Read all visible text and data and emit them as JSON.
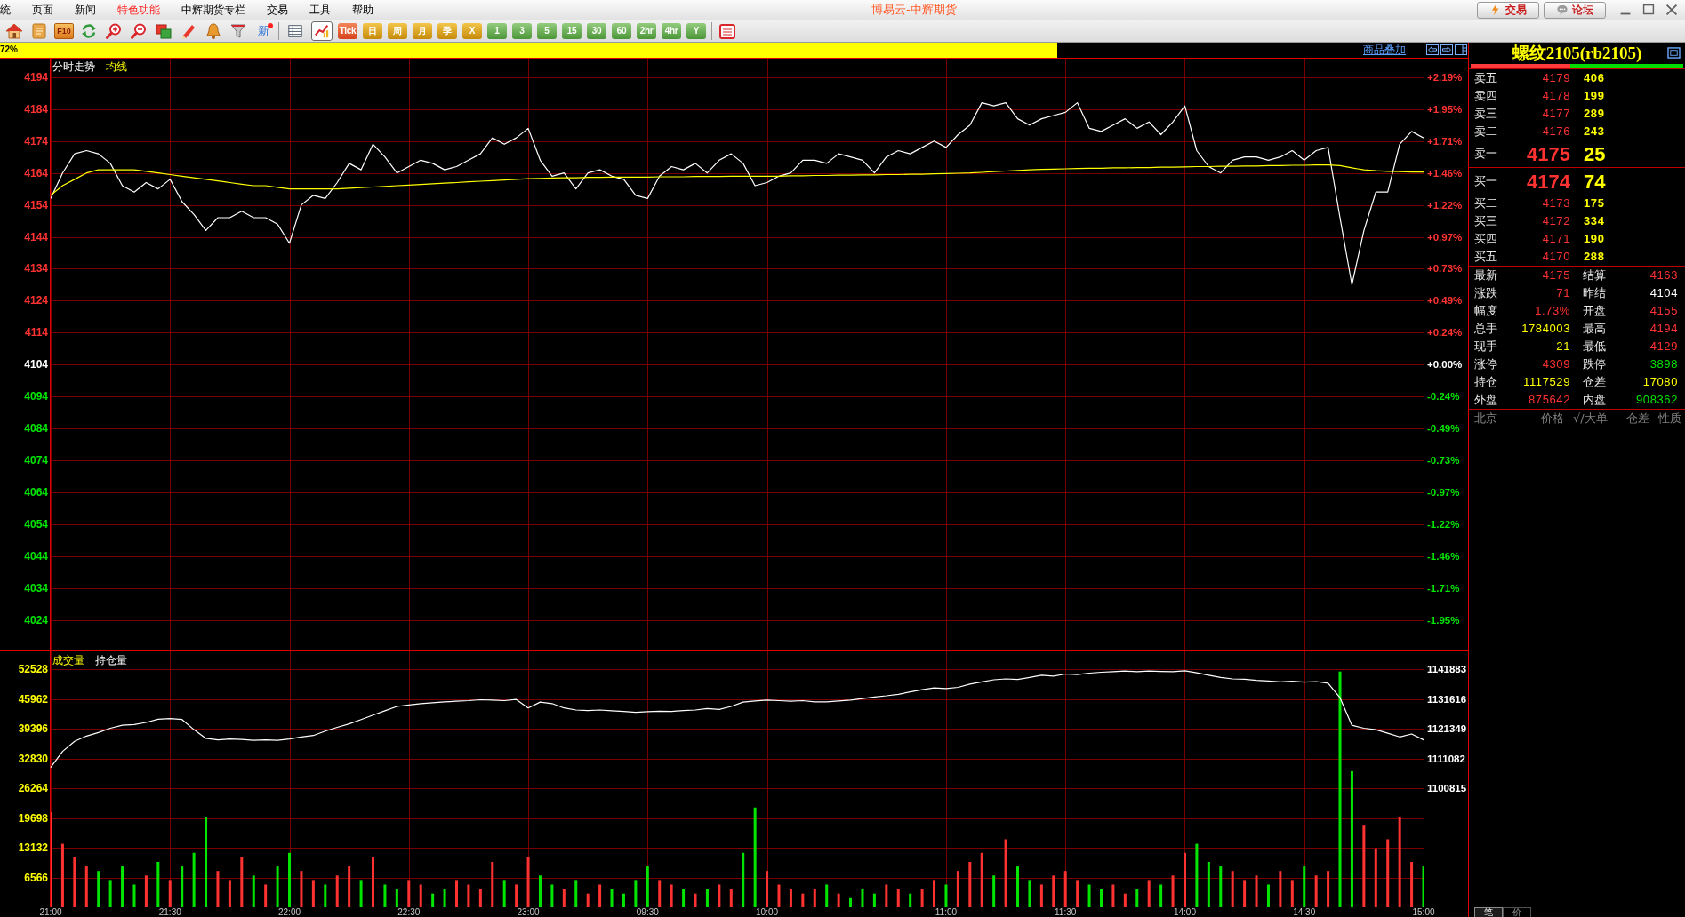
{
  "window": {
    "title": "博易云-中辉期货",
    "buttons": [
      {
        "label": "交易"
      },
      {
        "label": "论坛"
      }
    ]
  },
  "menu": [
    {
      "label": "统",
      "highlighted": false
    },
    {
      "label": "页面",
      "highlighted": false
    },
    {
      "label": "新闻",
      "highlighted": false
    },
    {
      "label": "特色功能",
      "highlighted": true
    },
    {
      "label": "中辉期货专栏",
      "highlighted": false
    },
    {
      "label": "交易",
      "highlighted": false
    },
    {
      "label": "工具",
      "highlighted": false
    },
    {
      "label": "帮助",
      "highlighted": false
    }
  ],
  "toolbar": {
    "doc_label": "F10",
    "news_label": "新",
    "views": [
      {
        "selected": false
      },
      {
        "selected": true
      }
    ],
    "periods": [
      {
        "label": "Tick",
        "kind": "tick"
      },
      {
        "label": "日",
        "kind": "day"
      },
      {
        "label": "周",
        "kind": "day"
      },
      {
        "label": "月",
        "kind": "day"
      },
      {
        "label": "季",
        "kind": "day"
      },
      {
        "label": "X",
        "kind": "day"
      },
      {
        "label": "1",
        "kind": "minute"
      },
      {
        "label": "3",
        "kind": "minute"
      },
      {
        "label": "5",
        "kind": "minute"
      },
      {
        "label": "15",
        "kind": "minute"
      },
      {
        "label": "30",
        "kind": "minute"
      },
      {
        "label": "60",
        "kind": "minute"
      },
      {
        "label": "2hr",
        "kind": "minute"
      },
      {
        "label": "4hr",
        "kind": "minute"
      },
      {
        "label": "Y",
        "kind": "minute"
      }
    ]
  },
  "status_bar": {
    "progress": {
      "level": 0.72,
      "label": "72%"
    },
    "link": "商品叠加"
  },
  "price_panel": {
    "chart_data": {
      "type": "line",
      "grid": true,
      "ylim": [
        4014.5,
        4199.8
      ],
      "yticks": [
        4194,
        4184,
        4174,
        4164,
        4154,
        4144,
        4134,
        4124,
        4114,
        4104,
        4094,
        4084,
        4074,
        4064,
        4054,
        4044,
        4034,
        4024
      ],
      "series": [
        {
          "name": "分时走势",
          "color": "#ffffff",
          "values": [
            4156,
            4164,
            4170,
            4171,
            4170,
            4167,
            4160,
            4158,
            4161,
            4159,
            4162,
            4155,
            4151,
            4146,
            4150,
            4150,
            4152,
            4150,
            4150,
            4148,
            4142,
            4154,
            4157,
            4156,
            4161,
            4167,
            4165,
            4173,
            4169,
            4164,
            4166,
            4168,
            4167,
            4165,
            4166,
            4168,
            4170,
            4175,
            4173,
            4175,
            4178,
            4168,
            4163,
            4164,
            4159,
            4164,
            4165,
            4163,
            4162,
            4157,
            4156,
            4163,
            4166,
            4165,
            4167,
            4164,
            4168,
            4170,
            4167,
            4160,
            4161,
            4163,
            4164,
            4168,
            4168,
            4167,
            4170,
            4169,
            4168,
            4164,
            4169,
            4171,
            4170,
            4172,
            4174,
            4172,
            4176,
            4179,
            4186,
            4185,
            4186,
            4181,
            4179,
            4181,
            4182,
            4183,
            4186,
            4178,
            4177,
            4179,
            4181,
            4178,
            4180,
            4176,
            4180,
            4185,
            4171,
            4166,
            4164,
            4168,
            4169,
            4169,
            4168,
            4169,
            4171,
            4168,
            4171,
            4172,
            4150,
            4129,
            4146,
            4158,
            4158,
            4173,
            4177,
            4175
          ]
        },
        {
          "name": "均线",
          "color": "#ffff00",
          "values": [
            4157,
            4160,
            4162,
            4164,
            4165,
            4165,
            4165,
            4165,
            4164.5,
            4164,
            4163.5,
            4163,
            4162.5,
            4162,
            4161.5,
            4161,
            4160.5,
            4160,
            4160,
            4159.5,
            4159,
            4159,
            4159,
            4159,
            4159,
            4159.2,
            4159.4,
            4159.6,
            4159.8,
            4160,
            4160.2,
            4160.4,
            4160.6,
            4160.8,
            4161,
            4161.2,
            4161.4,
            4161.6,
            4161.8,
            4162,
            4162.2,
            4162.3,
            4162.4,
            4162.5,
            4162.5,
            4162.6,
            4162.6,
            4162.7,
            4162.7,
            4162.7,
            4162.7,
            4162.8,
            4162.8,
            4162.8,
            4162.9,
            4162.9,
            4162.9,
            4163,
            4163,
            4163,
            4163,
            4163,
            4163.1,
            4163.1,
            4163.2,
            4163.2,
            4163.3,
            4163.3,
            4163.4,
            4163.4,
            4163.5,
            4163.5,
            4163.6,
            4163.6,
            4163.7,
            4163.8,
            4163.9,
            4164,
            4164.2,
            4164.4,
            4164.6,
            4164.8,
            4165,
            4165.1,
            4165.2,
            4165.3,
            4165.4,
            4165.5,
            4165.5,
            4165.6,
            4165.6,
            4165.7,
            4165.7,
            4165.8,
            4165.8,
            4165.9,
            4166,
            4166,
            4166.1,
            4166.1,
            4166.2,
            4166.2,
            4166.3,
            4166.3,
            4166.4,
            4166.4,
            4166.5,
            4166.5,
            4166.3,
            4165.6,
            4165,
            4164.7,
            4164.5,
            4164.4,
            4164.3,
            4164.3
          ]
        }
      ]
    },
    "right_axis_labels": [
      "+2.19%",
      "+1.95%",
      "+1.71%",
      "+1.46%",
      "+1.22%",
      "+0.97%",
      "+0.73%",
      "+0.49%",
      "+0.24%",
      "+0.00%",
      "-0.24%",
      "-0.49%",
      "-0.73%",
      "-0.97%",
      "-1.22%",
      "-1.46%",
      "-1.71%",
      "-1.95%"
    ]
  },
  "volume_panel": {
    "volume": {
      "chart_data": {
        "type": "bar",
        "grid": true,
        "categories": [
          "21:00",
          null,
          null,
          null,
          null,
          null,
          null,
          null,
          null,
          null,
          "21:30",
          null,
          null,
          null,
          null,
          null,
          null,
          null,
          null,
          null,
          "22:00",
          null,
          null,
          null,
          null,
          null,
          null,
          null,
          null,
          null,
          "22:30",
          null,
          null,
          null,
          null,
          null,
          null,
          null,
          null,
          null,
          "23:00",
          null,
          null,
          null,
          null,
          null,
          null,
          null,
          null,
          null,
          "09:30",
          null,
          null,
          null,
          null,
          null,
          null,
          null,
          null,
          null,
          "10:00",
          null,
          null,
          null,
          null,
          null,
          null,
          null,
          null,
          null,
          null,
          null,
          null,
          null,
          null,
          "11:00",
          null,
          null,
          null,
          null,
          null,
          null,
          null,
          null,
          null,
          "11:30",
          null,
          null,
          null,
          null,
          null,
          null,
          null,
          null,
          null,
          "14:00",
          null,
          null,
          null,
          null,
          null,
          null,
          null,
          null,
          null,
          "14:30",
          null,
          null,
          null,
          null,
          null,
          null,
          null,
          null,
          null,
          "15:00"
        ],
        "ylim": [
          0,
          56448
        ],
        "yticks": [
          52528,
          45962,
          39396,
          32830,
          26264,
          19698,
          13132,
          6566
        ],
        "series": [
          {
            "name": "成交量",
            "values": [
              21000,
              14000,
              11000,
              9000,
              8000,
              6000,
              9000,
              5000,
              7000,
              10000,
              6000,
              9000,
              12000,
              20000,
              8000,
              6000,
              11000,
              7000,
              5000,
              9000,
              12000,
              8000,
              6000,
              5000,
              7000,
              9000,
              6000,
              11000,
              5000,
              4000,
              6000,
              5000,
              3000,
              4000,
              6000,
              5000,
              4000,
              10000,
              6000,
              5000,
              11000,
              7000,
              5000,
              4000,
              6000,
              3000,
              5000,
              4000,
              3000,
              6000,
              9000,
              6000,
              5000,
              4000,
              3000,
              4000,
              5000,
              4000,
              12000,
              22000,
              8000,
              5000,
              4000,
              3000,
              4000,
              5000,
              3000,
              2000,
              4000,
              3000,
              5000,
              4000,
              3000,
              4000,
              6000,
              5000,
              8000,
              10000,
              12000,
              7000,
              15000,
              9000,
              6000,
              5000,
              7000,
              8000,
              6000,
              5000,
              4000,
              5000,
              3000,
              4000,
              6000,
              5000,
              7000,
              12000,
              14000,
              10000,
              9000,
              8000,
              6000,
              7000,
              5000,
              8000,
              6000,
              9000,
              7000,
              8000,
              52000,
              30000,
              18000,
              13000,
              15000,
              20000,
              10000,
              9000
            ]
          }
        ]
      }
    },
    "open_interest": {
      "chart_data": {
        "type": "line",
        "ylim": [
          1100815,
          1141883
        ],
        "yticks": [
          1141883,
          1131616,
          1121349,
          1111082,
          1100815
        ],
        "series": [
          {
            "name": "持仓量",
            "color": "#ffffff",
            "values": [
              1108000,
              1113500,
              1117000,
              1118800,
              1120000,
              1121500,
              1122500,
              1122800,
              1123500,
              1124600,
              1124800,
              1124500,
              1121000,
              1118000,
              1117500,
              1117800,
              1117600,
              1117300,
              1117500,
              1117300,
              1117800,
              1118500,
              1119000,
              1120500,
              1121800,
              1123000,
              1124500,
              1126000,
              1127500,
              1129000,
              1129500,
              1130000,
              1130300,
              1130600,
              1130800,
              1131000,
              1131300,
              1131200,
              1131000,
              1131400,
              1128500,
              1130500,
              1130000,
              1128500,
              1127800,
              1127600,
              1127800,
              1127500,
              1127300,
              1127000,
              1127200,
              1127400,
              1127300,
              1127600,
              1127800,
              1128300,
              1128000,
              1129000,
              1130500,
              1130900,
              1131200,
              1131000,
              1130800,
              1131000,
              1130600,
              1130600,
              1130900,
              1131200,
              1131700,
              1132300,
              1132700,
              1133200,
              1134000,
              1134800,
              1135400,
              1135200,
              1135600,
              1136700,
              1137500,
              1138200,
              1138500,
              1138300,
              1139000,
              1139800,
              1139500,
              1140200,
              1140000,
              1140500,
              1140800,
              1141000,
              1141200,
              1141000,
              1141200,
              1141100,
              1141000,
              1141300,
              1140600,
              1139800,
              1139000,
              1138500,
              1138400,
              1138000,
              1137800,
              1137500,
              1137700,
              1137400,
              1137600,
              1137000,
              1132000,
              1122500,
              1121500,
              1121000,
              1119800,
              1118500,
              1119500,
              1117500
            ]
          }
        ]
      }
    }
  },
  "quote_panel": {
    "title": "螺纹2105(rb2105)",
    "ratio_bar": {
      "level": 0.47
    },
    "asks": [
      {
        "label": "卖五",
        "price": "4179",
        "volume": "406",
        "best": false
      },
      {
        "label": "卖四",
        "price": "4178",
        "volume": "199",
        "best": false
      },
      {
        "label": "卖三",
        "price": "4177",
        "volume": "289",
        "best": false
      },
      {
        "label": "卖二",
        "price": "4176",
        "volume": "243",
        "best": false
      },
      {
        "label": "卖一",
        "price": "4175",
        "volume": "25",
        "best": true
      }
    ],
    "bids": [
      {
        "label": "买一",
        "price": "4174",
        "volume": "74",
        "best": true
      },
      {
        "label": "买二",
        "price": "4173",
        "volume": "175",
        "best": false
      },
      {
        "label": "买三",
        "price": "4172",
        "volume": "334",
        "best": false
      },
      {
        "label": "买四",
        "price": "4171",
        "volume": "190",
        "best": false
      },
      {
        "label": "买五",
        "price": "4170",
        "volume": "288",
        "best": false
      }
    ],
    "stats": [
      [
        {
          "label": "最新",
          "value": "4175",
          "color": "#ff3232"
        },
        {
          "label": "结算",
          "value": "4163",
          "color": "#ff3232"
        }
      ],
      [
        {
          "label": "涨跌",
          "value": "71",
          "color": "#ff3232"
        },
        {
          "label": "昨结",
          "value": "4104",
          "color": "#ffffff"
        }
      ],
      [
        {
          "label": "幅度",
          "value": "1.73%",
          "color": "#ff3232"
        },
        {
          "label": "开盘",
          "value": "4155",
          "color": "#ff3232"
        }
      ],
      [
        {
          "label": "总手",
          "value": "1784003",
          "color": "#ffff00"
        },
        {
          "label": "最高",
          "value": "4194",
          "color": "#ff3232"
        }
      ],
      [
        {
          "label": "现手",
          "value": "21",
          "color": "#ffff00"
        },
        {
          "label": "最低",
          "value": "4129",
          "color": "#ff3232"
        }
      ],
      [
        {
          "label": "涨停",
          "value": "4309",
          "color": "#ff3232"
        },
        {
          "label": "跌停",
          "value": "3898",
          "color": "#00e600"
        }
      ],
      [
        {
          "label": "持仓",
          "value": "1117529",
          "color": "#ffff00"
        },
        {
          "label": "仓差",
          "value": "17080",
          "color": "#ffff00"
        }
      ],
      [
        {
          "label": "外盘",
          "value": "875642",
          "color": "#ff3232"
        },
        {
          "label": "内盘",
          "value": "908362",
          "color": "#00e600"
        }
      ]
    ],
    "tick_header": [
      "北京",
      "价格",
      "√/大单",
      "仓差",
      "性质"
    ],
    "tabs": [
      {
        "label": "笔",
        "selected": true
      },
      {
        "label": "价",
        "selected": false
      }
    ]
  }
}
